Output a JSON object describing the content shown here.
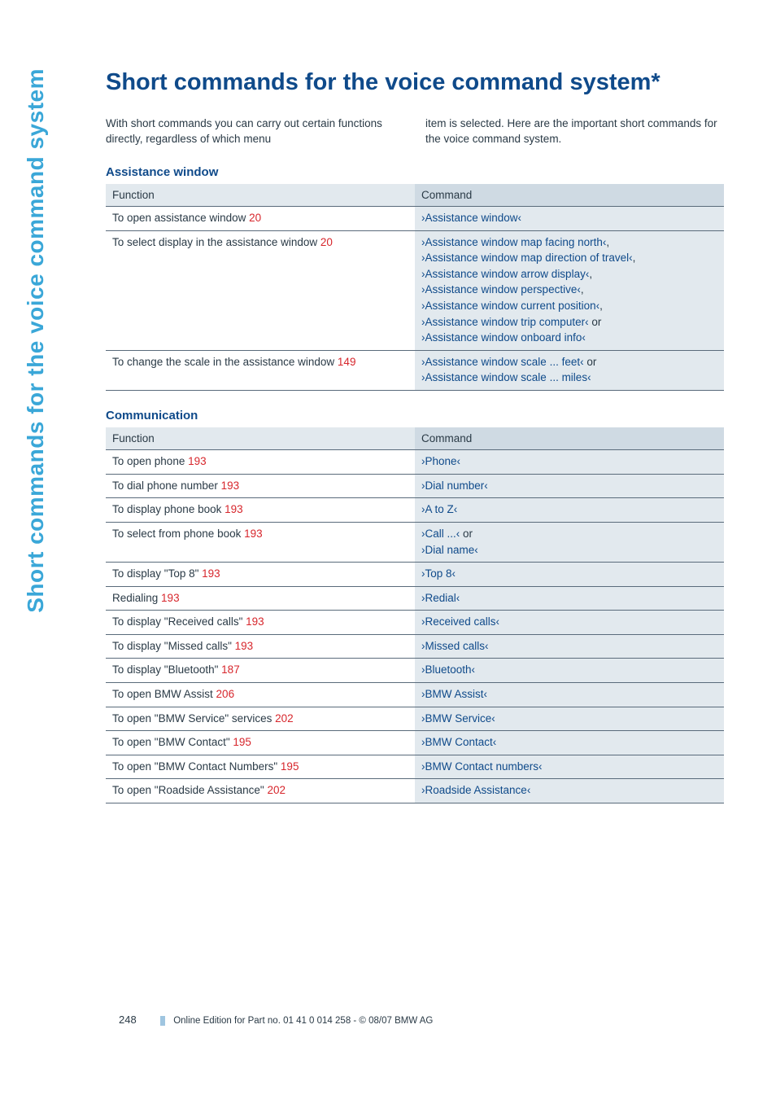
{
  "side_tab": "Short commands for the voice command system",
  "title": "Short commands for the voice command system*",
  "intro_left": "With short commands you can carry out certain functions directly, regardless of which menu",
  "intro_right": "item is selected. Here are the important short commands for the voice command system.",
  "section1_title": "Assistance window",
  "section2_title": "Communication",
  "head_function": "Function",
  "head_command": "Command",
  "table1": [
    {
      "func": "To open assistance window",
      "page": "20",
      "cmds": [
        {
          "t": "›Assistance window‹",
          "c": "blue"
        }
      ]
    },
    {
      "func": "To select display in the assistance window",
      "page": "20",
      "cmds": [
        {
          "t": "›Assistance window map facing north‹",
          "c": "blue"
        },
        {
          "t": ",",
          "c": "plain"
        },
        {
          "br": true
        },
        {
          "t": "›Assistance window map direction of travel‹",
          "c": "blue"
        },
        {
          "t": ",",
          "c": "plain"
        },
        {
          "br": true
        },
        {
          "t": "›Assistance window arrow display‹",
          "c": "blue"
        },
        {
          "t": ",",
          "c": "plain"
        },
        {
          "br": true
        },
        {
          "t": "›Assistance window perspective‹",
          "c": "blue"
        },
        {
          "t": ",",
          "c": "plain"
        },
        {
          "br": true
        },
        {
          "t": "›Assistance window current position‹",
          "c": "blue"
        },
        {
          "t": ",",
          "c": "plain"
        },
        {
          "br": true
        },
        {
          "t": "›Assistance window trip computer‹",
          "c": "blue"
        },
        {
          "t": " or",
          "c": "plain"
        },
        {
          "br": true
        },
        {
          "t": "›Assistance window onboard info‹",
          "c": "blue"
        }
      ]
    },
    {
      "func": "To change the scale in the assistance window",
      "page": "149",
      "cmds": [
        {
          "t": "›Assistance window scale ... feet‹",
          "c": "blue"
        },
        {
          "t": " or",
          "c": "plain"
        },
        {
          "br": true
        },
        {
          "t": "›Assistance window scale ... miles‹",
          "c": "blue"
        }
      ]
    }
  ],
  "table2": [
    {
      "func": "To open phone",
      "page": "193",
      "cmds": [
        {
          "t": "›Phone‹",
          "c": "blue"
        }
      ]
    },
    {
      "func": "To dial phone number",
      "page": "193",
      "cmds": [
        {
          "t": "›Dial number‹",
          "c": "blue"
        }
      ]
    },
    {
      "func": "To display phone book",
      "page": "193",
      "cmds": [
        {
          "t": "›A to Z‹",
          "c": "blue"
        }
      ]
    },
    {
      "func": "To select from phone book",
      "page": "193",
      "cmds": [
        {
          "t": "›Call ...‹",
          "c": "blue"
        },
        {
          "t": " or",
          "c": "plain"
        },
        {
          "br": true
        },
        {
          "t": "›Dial name‹",
          "c": "blue"
        }
      ]
    },
    {
      "func": "To display \"Top 8\"",
      "page": "193",
      "cmds": [
        {
          "t": "›Top 8‹",
          "c": "blue"
        }
      ]
    },
    {
      "func": "Redialing",
      "page": "193",
      "cmds": [
        {
          "t": "›Redial‹",
          "c": "blue"
        }
      ]
    },
    {
      "func": "To display \"Received calls\"",
      "page": "193",
      "cmds": [
        {
          "t": "›Received calls‹",
          "c": "blue"
        }
      ]
    },
    {
      "func": "To display \"Missed calls\"",
      "page": "193",
      "cmds": [
        {
          "t": "›Missed calls‹",
          "c": "blue"
        }
      ]
    },
    {
      "func": "To display \"Bluetooth\"",
      "page": "187",
      "cmds": [
        {
          "t": "›Bluetooth‹",
          "c": "blue"
        }
      ]
    },
    {
      "func": "To open BMW Assist",
      "page": "206",
      "cmds": [
        {
          "t": "›BMW Assist‹",
          "c": "blue"
        }
      ]
    },
    {
      "func": "To open \"BMW Service\" services",
      "page": "202",
      "cmds": [
        {
          "t": "›BMW Service‹",
          "c": "blue"
        }
      ]
    },
    {
      "func": "To open \"BMW Contact\"",
      "page": "195",
      "cmds": [
        {
          "t": "›BMW Contact‹",
          "c": "blue"
        }
      ]
    },
    {
      "func": "To open \"BMW Contact Numbers\"",
      "page": "195",
      "cmds": [
        {
          "t": "›BMW Contact numbers‹",
          "c": "blue"
        }
      ]
    },
    {
      "func": "To open \"Roadside Assistance\"",
      "page": "202",
      "cmds": [
        {
          "t": "›Roadside Assistance‹",
          "c": "blue"
        }
      ]
    }
  ],
  "footer_page": "248",
  "footer_text": "Online Edition for Part no. 01 41 0 014 258 - © 08/07 BMW AG"
}
